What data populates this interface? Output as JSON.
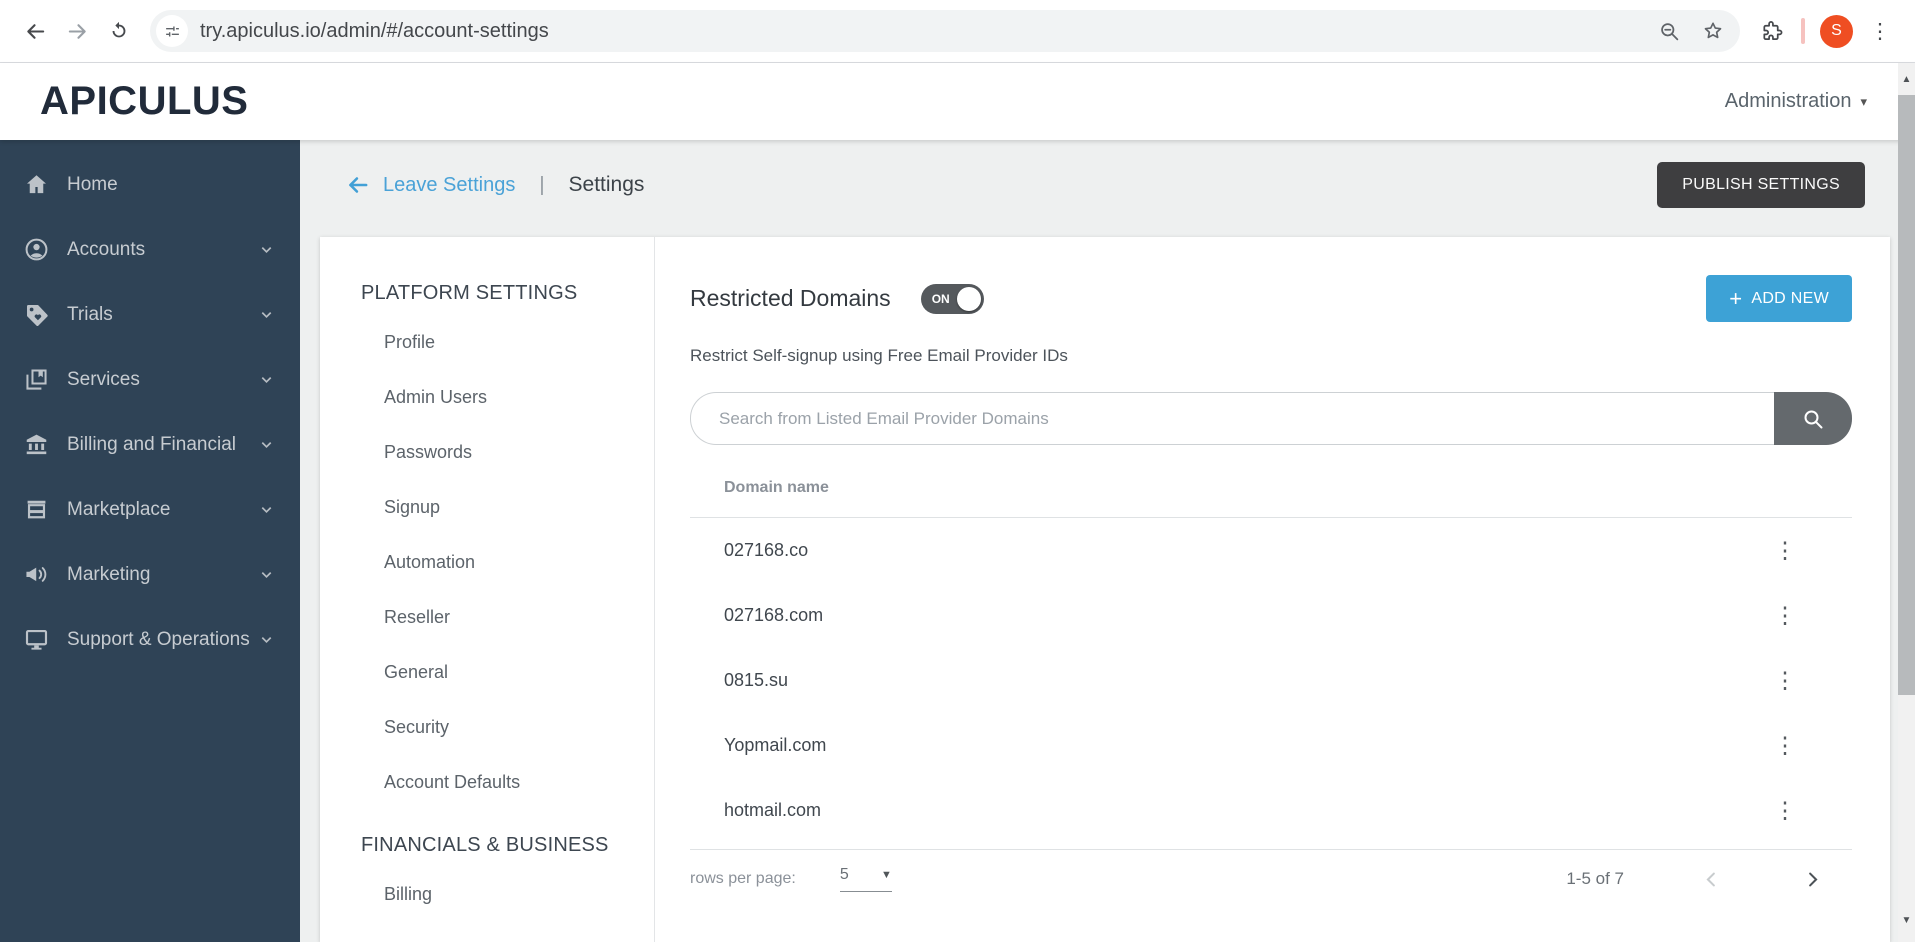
{
  "browser": {
    "url": "try.apiculus.io/admin/#/account-settings",
    "avatar_letter": "S"
  },
  "header": {
    "logo": "APICULUS",
    "admin_menu": "Administration"
  },
  "sidebar": {
    "items": [
      {
        "label": "Home",
        "icon": "home-icon",
        "expandable": false
      },
      {
        "label": "Accounts",
        "icon": "accounts-icon",
        "expandable": true
      },
      {
        "label": "Trials",
        "icon": "trials-tag-icon",
        "expandable": true
      },
      {
        "label": "Services",
        "icon": "services-icon",
        "expandable": true
      },
      {
        "label": "Billing and Financial",
        "icon": "billing-bank-icon",
        "expandable": true
      },
      {
        "label": "Marketplace",
        "icon": "marketplace-store-icon",
        "expandable": true
      },
      {
        "label": "Marketing",
        "icon": "marketing-megaphone-icon",
        "expandable": true
      },
      {
        "label": "Support & Operations",
        "icon": "support-monitor-icon",
        "expandable": true
      }
    ]
  },
  "page_header": {
    "back_link": "Leave Settings",
    "separator": "|",
    "title": "Settings",
    "publish_button": "PUBLISH SETTINGS"
  },
  "settings_nav": {
    "sections": [
      {
        "heading": "PLATFORM SETTINGS",
        "items": [
          "Profile",
          "Admin Users",
          "Passwords",
          "Signup",
          "Automation",
          "Reseller",
          "General",
          "Security",
          "Account Defaults"
        ]
      },
      {
        "heading": "FINANCIALS & BUSINESS",
        "items": [
          "Billing"
        ]
      }
    ]
  },
  "content": {
    "title": "Restricted Domains",
    "toggle_label": "ON",
    "toggle_state": "on",
    "subtitle": "Restrict Self-signup using Free Email Provider IDs",
    "search_placeholder": "Search from Listed Email Provider Domains",
    "add_button_plus": "+",
    "add_button_label": "ADD NEW",
    "table": {
      "column_header": "Domain name",
      "rows": [
        "027168.co",
        "027168.com",
        "0815.su",
        "Yopmail.com",
        "hotmail.com"
      ]
    },
    "pagination": {
      "rows_per_page_label": "rows per page:",
      "rows_per_page_value": "5",
      "range_text": "1-5 of 7"
    }
  },
  "colors": {
    "accent_blue": "#3da2d6",
    "sidebar_bg": "#2f4356",
    "publish_button_bg": "#3e3e40",
    "toggle_bg": "#55595d",
    "avatar_bg": "#ef4e22",
    "main_bg": "#eef0f0"
  }
}
